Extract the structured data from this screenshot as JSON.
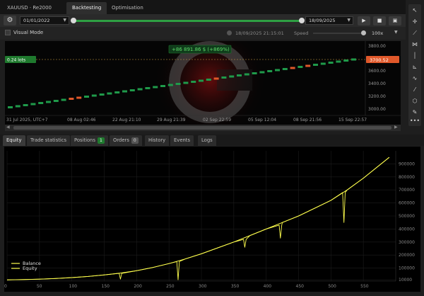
{
  "top_tabs": {
    "symbol_tab": "XAUUSD · Re2000",
    "backtesting_tab": "Backtesting",
    "optimisation_tab": "Optimisation"
  },
  "controls": {
    "start_date": "01/01/2022",
    "end_date": "18/09/2025",
    "current_time": "18/09/2025 21:15:01",
    "speed_label": "Speed",
    "speed_value": "100x",
    "visual_mode_label": "Visual Mode",
    "progress_percent": 100
  },
  "chart": {
    "pnl_label": "+86 891.86 $ (+869%)",
    "position_label": "0.24 lots",
    "current_price": "3700.52",
    "price_ticks": [
      "3800.00",
      "3600.00",
      "3400.00",
      "3200.00",
      "3000.00"
    ],
    "time_ticks": [
      "31 Jul 2025, UTC+7",
      "08 Aug 02:46",
      "22 Aug 21:10",
      "29 Aug 21:39",
      "02 Sep 22:59",
      "05 Sep 12:04",
      "08 Sep 21:56",
      "15 Sep 22:57"
    ]
  },
  "bottom_tabs": {
    "equity": "Equity",
    "trade_statistics": "Trade statistics",
    "positions": "Positions",
    "positions_count": "1",
    "orders": "Orders",
    "orders_count": "0",
    "history": "History",
    "events": "Events",
    "logs": "Logs"
  },
  "chart_data": {
    "type": "line",
    "xlim": [
      0,
      600
    ],
    "ylim": [
      0,
      1000000
    ],
    "x_ticks": [
      0,
      50,
      100,
      150,
      200,
      250,
      300,
      350,
      400,
      450,
      500,
      550
    ],
    "y_ticks": [
      "10000",
      "100000",
      "200000",
      "300000",
      "400000",
      "500000",
      "600000",
      "700000",
      "800000",
      "900000"
    ],
    "legend": [
      "Balance",
      "Equity"
    ],
    "legend_position": "bottom-left",
    "series": [
      {
        "name": "Balance",
        "color": "#ffff4d",
        "x": [
          0,
          25,
          50,
          75,
          100,
          125,
          150,
          175,
          200,
          225,
          250,
          275,
          300,
          325,
          350,
          375,
          400,
          425,
          450,
          475,
          500,
          525,
          550,
          575,
          590
        ],
        "values": [
          10000,
          12000,
          15000,
          20000,
          27000,
          36000,
          48000,
          62000,
          80000,
          105000,
          135000,
          170000,
          210000,
          255000,
          300000,
          350000,
          400000,
          450000,
          500000,
          560000,
          620000,
          700000,
          790000,
          890000,
          950000
        ]
      },
      {
        "name": "Equity",
        "color": "#ffff4d",
        "x": [
          0,
          25,
          50,
          75,
          100,
          125,
          150,
          173,
          175,
          177,
          200,
          225,
          250,
          262,
          264,
          266,
          275,
          300,
          325,
          350,
          365,
          367,
          369,
          375,
          400,
          420,
          422,
          424,
          425,
          450,
          475,
          500,
          518,
          520,
          522,
          525,
          550,
          575,
          590
        ],
        "values": [
          10000,
          12000,
          15000,
          20000,
          27000,
          36000,
          48000,
          60000,
          15000,
          60000,
          80000,
          105000,
          135000,
          150000,
          10000,
          150000,
          170000,
          210000,
          255000,
          300000,
          320000,
          260000,
          320000,
          350000,
          400000,
          430000,
          330000,
          430000,
          450000,
          500000,
          560000,
          620000,
          680000,
          450000,
          680000,
          700000,
          790000,
          890000,
          950000
        ]
      }
    ]
  }
}
